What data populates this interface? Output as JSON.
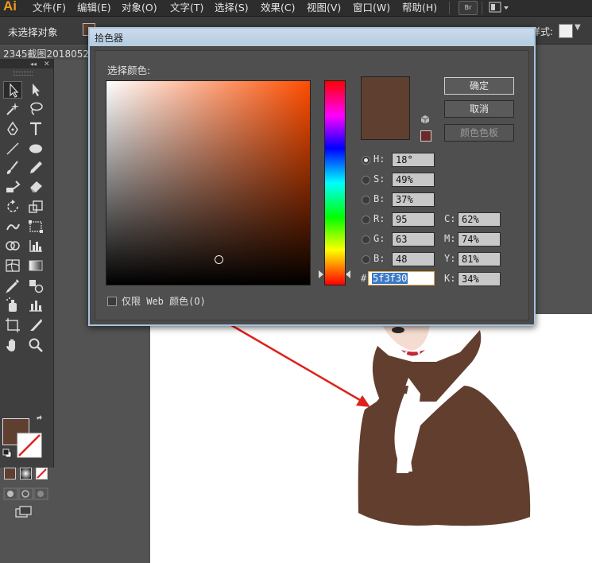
{
  "app": {
    "logo": "Ai"
  },
  "menubar": {
    "items": [
      "文件(F)",
      "编辑(E)",
      "对象(O)",
      "文字(T)",
      "选择(S)",
      "效果(C)",
      "视图(V)",
      "窗口(W)",
      "帮助(H)"
    ],
    "bridge_label": "Br"
  },
  "controlbar": {
    "selection_status": "未选择对象",
    "style_label": "样式:"
  },
  "document_tab": {
    "label": "2345截图2018052"
  },
  "colors": {
    "current_color": "#5f3f30",
    "dialog_title_bar": "#b5cbe0",
    "artboard": "#ffffff"
  },
  "color_picker": {
    "title": "拾色器",
    "choose_label": "选择颜色:",
    "buttons": {
      "ok": "确定",
      "cancel": "取消",
      "swatches": "颜色色板"
    },
    "hsb": [
      {
        "label": "H:",
        "value": "18°",
        "selected": true
      },
      {
        "label": "S:",
        "value": "49%",
        "selected": false
      },
      {
        "label": "B:",
        "value": "37%",
        "selected": false
      }
    ],
    "rgb": [
      {
        "label": "R:",
        "value": "95"
      },
      {
        "label": "G:",
        "value": "63"
      },
      {
        "label": "B:",
        "value": "48"
      }
    ],
    "cmyk": [
      {
        "label": "C:",
        "value": "62%"
      },
      {
        "label": "M:",
        "value": "74%"
      },
      {
        "label": "Y:",
        "value": "81%"
      },
      {
        "label": "K:",
        "value": "34%"
      }
    ],
    "hex_label": "#",
    "hex_value": "5f3f30",
    "web_only_label": "仅限 Web 颜色(O)",
    "web_only_checked": false
  }
}
